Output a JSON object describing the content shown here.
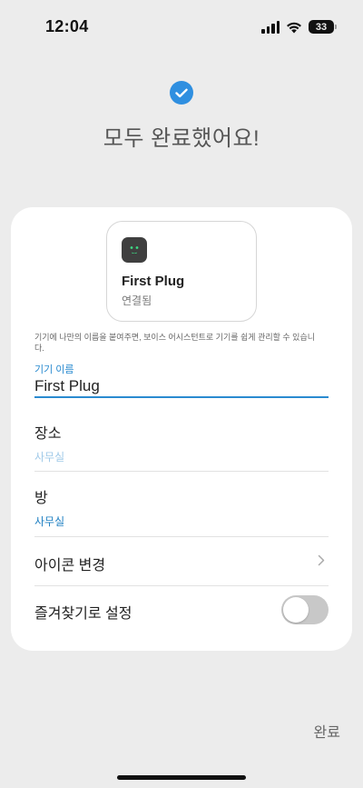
{
  "status_bar": {
    "time": "12:04",
    "battery_level": "33"
  },
  "header": {
    "title": "모두 완료했어요!"
  },
  "device": {
    "name": "First Plug",
    "status": "연결됨",
    "icon": "plug-icon"
  },
  "hint": "기기에 나만의 이름을 붙여주면, 보이스 어시스턴트로 기기를 쉽게 관리할 수 있습니다.",
  "name_field": {
    "label": "기기 이름",
    "value": "First Plug"
  },
  "location_row": {
    "title": "장소",
    "value": "사무실"
  },
  "room_row": {
    "title": "방",
    "value": "사무실"
  },
  "icon_row": {
    "title": "아이콘 변경"
  },
  "favorite_row": {
    "title": "즐겨찾기로 설정",
    "enabled": false
  },
  "footer": {
    "complete_label": "완료"
  },
  "colors": {
    "accent": "#2a8bd0",
    "check": "#2f8fe0",
    "background": "#ececec"
  }
}
